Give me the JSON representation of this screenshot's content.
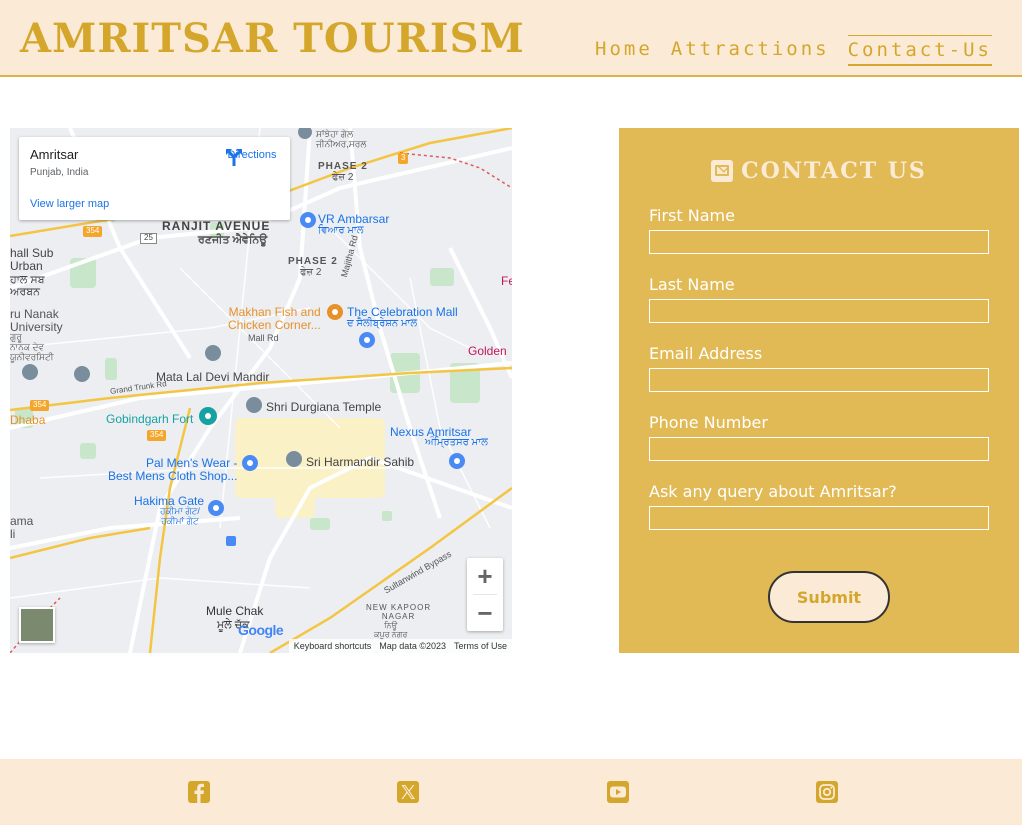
{
  "header": {
    "brand": "AMRITSAR TOURISM",
    "nav": [
      {
        "label": "Home"
      },
      {
        "label": "Attractions"
      },
      {
        "label": "Contact-Us"
      }
    ]
  },
  "map": {
    "card": {
      "place": "Amritsar",
      "region": "Punjab, India",
      "directions": "Directions",
      "view_larger": "View larger map"
    },
    "labels": {
      "ranjit_avenue": "RANJIT AVENUE",
      "ranjit_avenue_pa": "ਰਣਜੀਤ ਐਵੇਨਿਊ",
      "phase2_top": "PHASE 2",
      "phase2_top_pa": "ਫੇਜ਼ 2",
      "phase2_mid": "PHASE 2",
      "phase2_mid_pa": "ਫੇਜ਼ 2",
      "vr_ambarsar": "VR Ambarsar",
      "vr_ambarsar_pa": "ਵਿਆਰ ਮਾਲ",
      "makhan_fish": "Makhan Fish and\nChicken Corner...",
      "celebration_mall": "The Celebration Mall",
      "celebration_mall_pa": "ਦ ਸੈਲੀਬ੍ਰੇਸ਼ਨ ਮਾਲ",
      "mall_rd": "Mall Rd",
      "majitha_rd": "Majitha Rd",
      "golden": "Golden",
      "guru_nanak": "ru Nanak\nUniversity",
      "guru_nanak_pa": "ਗੁਰੂ\nਨਾਨਕ ਦੇਵ\nਯੂਨੀਵਰਸਿਟੀ",
      "hall_sub": "hall Sub\nUrban",
      "hall_sub_pa": "ਹਾਲ ਸਬ\nਅਰਬਨ",
      "mata_lal_devi": "Mata Lal Devi Mandir",
      "grand_trunk": "Grand Trunk Rd",
      "gobindgarh": "Gobindgarh Fort",
      "durgiana": "Shri Durgiana Temple",
      "dhaba": "Dhaba",
      "nexus": "Nexus Amritsar",
      "nexus_pa": "ਅੰਮ੍ਰਿਤਸਰ ਮਾਲ",
      "pal_mens": "Pal Men's Wear -\nBest Mens Cloth Shop...",
      "harmandir": "Sri Harmandir Sahib",
      "hakima": "Hakima Gate",
      "hakima_pa": "ਹਕੀਮਾ ਗੇਟ/\nਹਕੀਮਾਂ ਗੇਟ",
      "sultanwind": "Sultanwind Bypass",
      "mule_chak": "Mule Chak",
      "mule_chak_pa": "ਮੂਲੇ ਚੱਕ",
      "new_kapoor": "NEW KAPOOR\nNAGAR",
      "new_kapoor_pa": "ਨਿਊ\nਕਪੂਰ ਨਗਰ",
      "ama": "ama\nli",
      "fe": "Fe",
      "top_pa": "ਸਾਂਝੇਹਾ ਗੇਲ\nਜੀਨੀਅਰ,ਸਰਲ",
      "road_354": "354",
      "road_25": "25",
      "road_3": "3",
      "google": "Google"
    },
    "zoom_in": "+",
    "zoom_out": "−",
    "attribution": [
      "Keyboard shortcuts",
      "Map data ©2023",
      "Terms of Use"
    ]
  },
  "contact": {
    "title": "CONTACT US",
    "fields": [
      {
        "label": "First Name",
        "value": ""
      },
      {
        "label": "Last Name",
        "value": ""
      },
      {
        "label": "Email Address",
        "value": ""
      },
      {
        "label": "Phone Number",
        "value": ""
      },
      {
        "label": "Ask any query about Amritsar?",
        "value": ""
      }
    ],
    "submit": "Submit"
  },
  "footer": {
    "icons": [
      "facebook-icon",
      "x-twitter-icon",
      "youtube-icon",
      "instagram-icon"
    ],
    "icon_color": "#d4a72c"
  },
  "colors": {
    "gold": "#d4a72c",
    "panel": "#e2ba55",
    "cream": "#fbebd6"
  }
}
